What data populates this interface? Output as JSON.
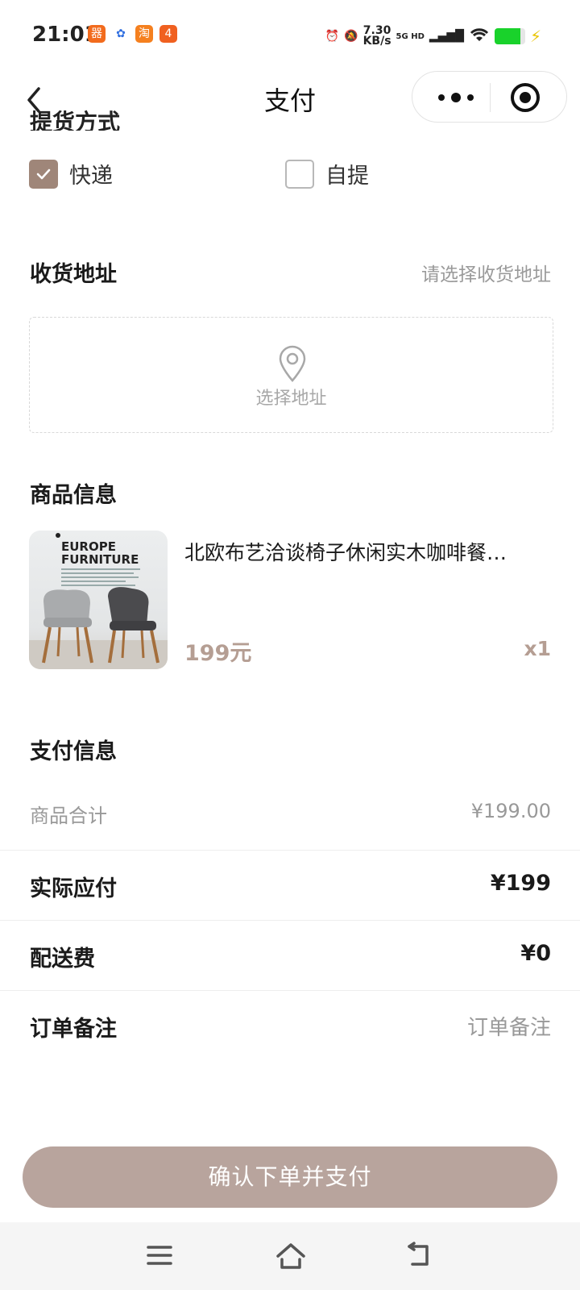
{
  "status_bar": {
    "time": "21:01",
    "net_speed_value": "7.30",
    "net_speed_unit": "KB/s",
    "network_type": "5G HD",
    "battery_level": 0.85,
    "app_icons": [
      {
        "name": "app-icon-1",
        "color": "#f26b1d",
        "glyph": "器"
      },
      {
        "name": "app-icon-2",
        "color": "#2f6ee0",
        "glyph": "✿"
      },
      {
        "name": "app-icon-3",
        "color": "#f5801f",
        "glyph": "淘"
      },
      {
        "name": "app-icon-4",
        "color": "#f06020",
        "glyph": "4"
      }
    ]
  },
  "nav": {
    "title": "支付"
  },
  "delivery": {
    "options": [
      {
        "label": "快递",
        "checked": true
      },
      {
        "label": "自提",
        "checked": false
      }
    ]
  },
  "address": {
    "title": "收货地址",
    "hint": "请选择收货地址",
    "box_label": "选择地址"
  },
  "product_section": {
    "title": "商品信息",
    "image_text_line1": "EUROPE",
    "image_text_line2": "FURNITURE",
    "name": "北欧布艺洽谈椅子休闲实木咖啡餐…",
    "price": "199元",
    "quantity": "x1"
  },
  "payment": {
    "title": "支付信息",
    "subtotal_label": "商品合计",
    "subtotal_value": "¥199.00",
    "actual_label": "实际应付",
    "actual_value": "¥199",
    "shipping_label": "配送费",
    "shipping_value": "¥0",
    "note_label": "订单备注",
    "note_placeholder": "订单备注"
  },
  "footer": {
    "confirm_button": "确认下单并支付"
  },
  "colors": {
    "accent": "#9f8679",
    "price": "#b59e93",
    "button": "#b8a49d"
  }
}
